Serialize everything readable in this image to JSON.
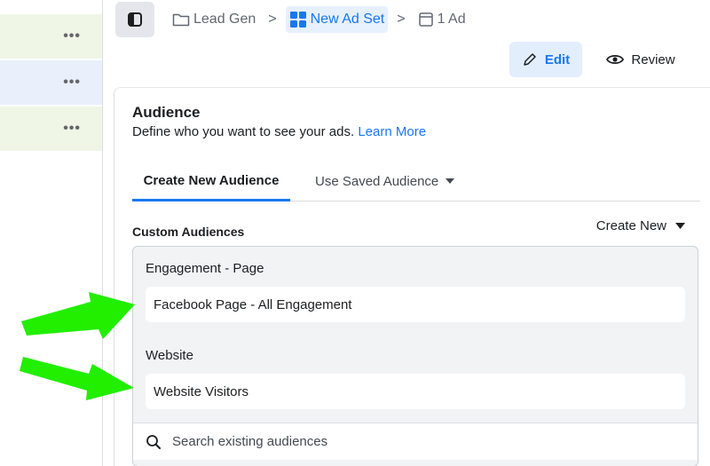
{
  "left_rows": [
    {
      "more": "•••"
    },
    {
      "more": "•••"
    },
    {
      "more": "•••"
    }
  ],
  "breadcrumb": {
    "campaign": "Lead Gen",
    "ad_set": "New Ad Set",
    "ad": "1 Ad",
    "separator": ">"
  },
  "actions": {
    "edit_label": "Edit",
    "review_label": "Review"
  },
  "audience": {
    "title": "Audience",
    "description": "Define who you want to see your ads.",
    "learn_more": "Learn More",
    "tabs": {
      "create_new": "Create New Audience",
      "use_saved": "Use Saved Audience"
    },
    "custom_label": "Custom Audiences",
    "create_new_label": "Create New",
    "groups": [
      {
        "label": "Engagement - Page",
        "item": "Facebook Page - All Engagement"
      },
      {
        "label": "Website",
        "item": "Website Visitors"
      }
    ],
    "search_placeholder": "Search existing audiences"
  },
  "colors": {
    "accent": "#1877f2",
    "arrow": "#22ee00",
    "row_green": "#eff6e6",
    "row_blue": "#e9f0fb"
  },
  "icons": {
    "sidebar_toggle": "sidebar-toggle-icon",
    "folder": "folder-icon",
    "grid": "grid-icon",
    "ad": "ad-icon",
    "pencil": "pencil-icon",
    "eye": "eye-icon",
    "caret": "caret-down-icon",
    "search": "search-icon"
  }
}
